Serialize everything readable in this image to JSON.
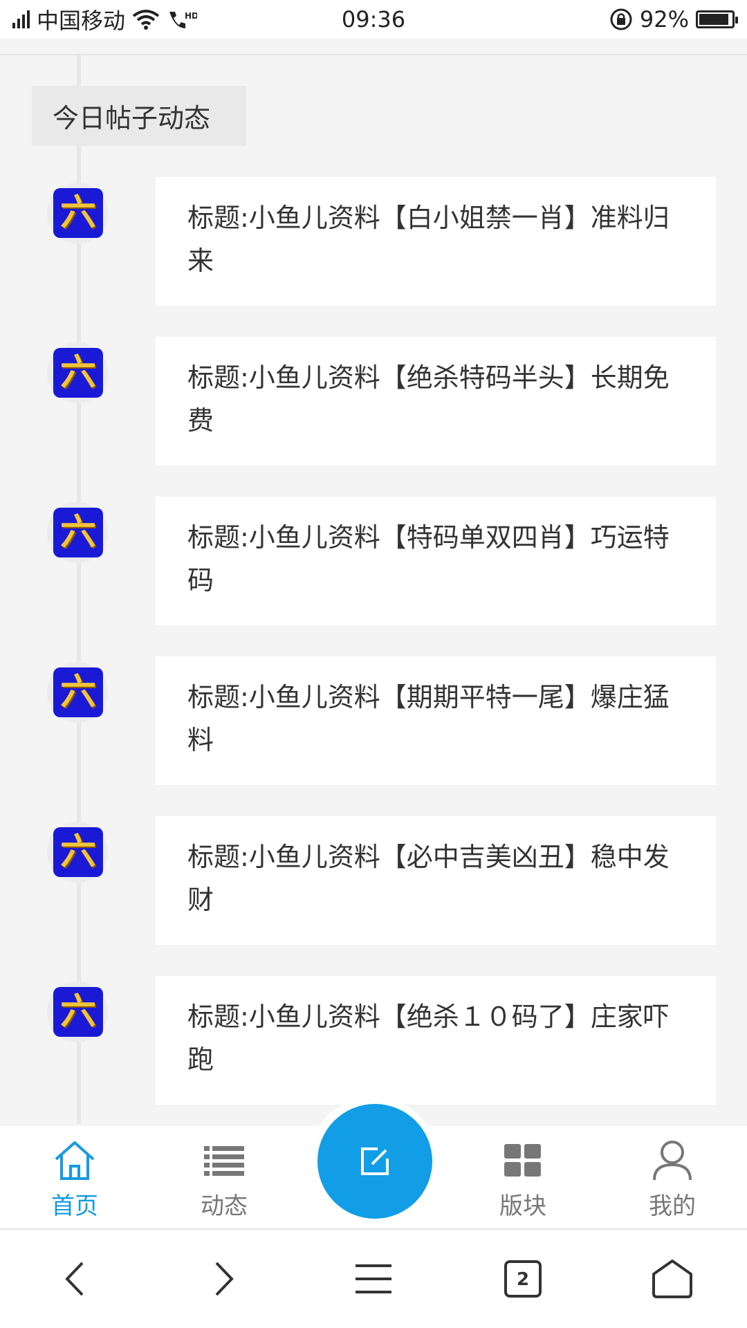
{
  "status_bar": {
    "carrier": "中国移动",
    "time": "09:36",
    "battery_percent": "92%",
    "battery_level": 0.92
  },
  "section": {
    "title": "今日帖子动态"
  },
  "posts": [
    {
      "avatar_char": "六",
      "title": "标题:小鱼儿资料【白小姐禁一肖】准料归来"
    },
    {
      "avatar_char": "六",
      "title": "标题:小鱼儿资料【绝杀特码半头】长期免费"
    },
    {
      "avatar_char": "六",
      "title": "标题:小鱼儿资料【特码单双四肖】巧运特码"
    },
    {
      "avatar_char": "六",
      "title": "标题:小鱼儿资料【期期平特一尾】爆庄猛料"
    },
    {
      "avatar_char": "六",
      "title": "标题:小鱼儿资料【必中吉美凶丑】稳中发财"
    },
    {
      "avatar_char": "六",
      "title": "标题:小鱼儿资料【绝杀１０码了】庄家吓跑"
    }
  ],
  "tabbar": {
    "home": "首页",
    "feed": "动态",
    "boards": "版块",
    "me": "我的",
    "active_color": "#159be0",
    "fab_color": "#119ee6"
  },
  "navbar": {
    "tab_count": "2"
  }
}
